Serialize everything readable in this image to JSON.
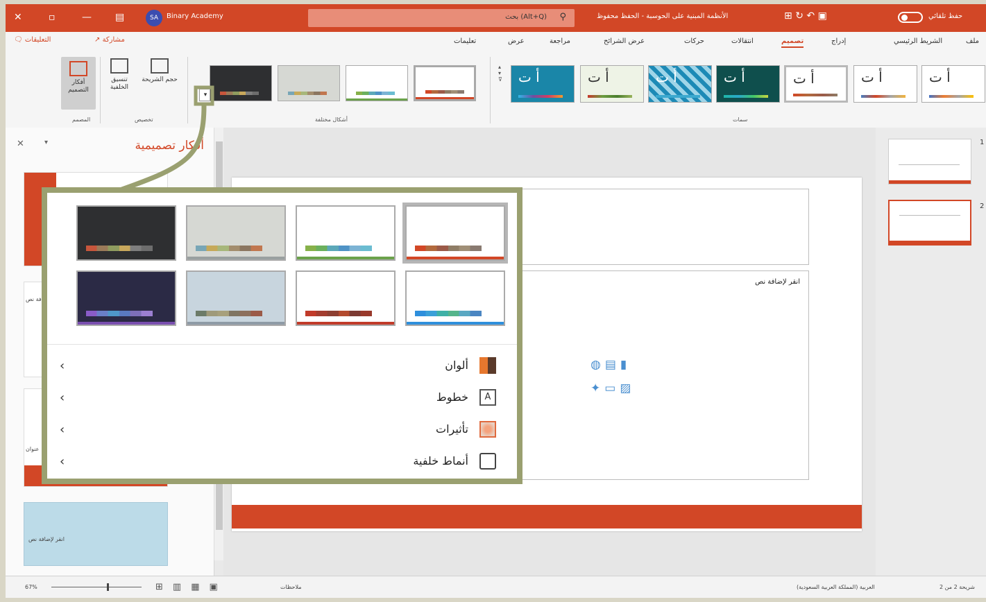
{
  "titlebar": {
    "account_initials": "SA",
    "account_name": "Binary Academy",
    "search_placeholder": "بحث (Alt+Q)",
    "document_title": "الأنظمة المبنية على الحوسبة - الحفظ محفوظ",
    "autosave_label": "حفظ تلقائي"
  },
  "menu": {
    "comments": "التعليقات",
    "share": "مشاركة",
    "tabs": [
      "ملف",
      "الشريط الرئيسي",
      "إدراج",
      "تصميم",
      "انتقالات",
      "حركات",
      "عرض الشرائح",
      "مراجعة",
      "عرض",
      "تعليمات"
    ],
    "active_tab": "تصميم"
  },
  "ribbon": {
    "designer_button": "أفكار التصميم",
    "format_bg_button": "تنسيق الخلفية",
    "slide_size_button": "حجم الشريحة",
    "group_designer": "المصمم",
    "group_customize": "تخصيص",
    "group_variants": "أشكال مختلفة",
    "group_themes": "سمات",
    "theme_glyph": "أ ت"
  },
  "design_pane": {
    "title": "أفكار تصميمية",
    "card_text_a": "انقر لإضافة نص",
    "card_text_b": "عنوان"
  },
  "slide": {
    "content_hint": "انقر لإضافة نص"
  },
  "thumbnails": {
    "numbers": [
      "1",
      "2"
    ]
  },
  "popup": {
    "rows": [
      {
        "label": "ألوان",
        "icon": "colors-icon"
      },
      {
        "label": "خطوط",
        "icon": "fonts-icon"
      },
      {
        "label": "تأثيرات",
        "icon": "effects-icon"
      },
      {
        "label": "أنماط خلفية",
        "icon": "background-styles-icon"
      }
    ]
  },
  "statusbar": {
    "zoom": "67%",
    "notes": "ملاحظات",
    "language": "العربية (المملكة العربية السعودية)",
    "slide_counter": "شريحة 2 من 2"
  },
  "colors": {
    "accent": "#d24726",
    "callout": "#9aa070"
  }
}
